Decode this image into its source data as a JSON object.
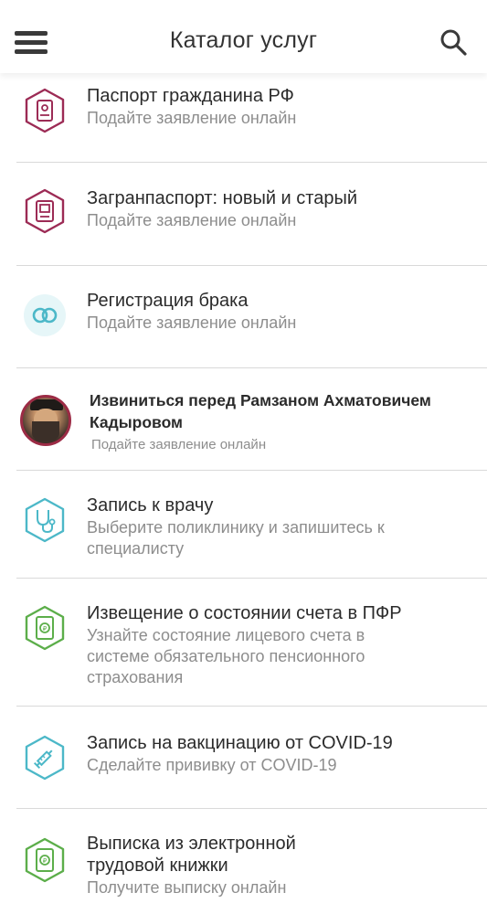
{
  "header": {
    "title": "Каталог услуг"
  },
  "items": [
    {
      "title": "Паспорт гражданина РФ",
      "subtitle": "Подайте заявление онлайн",
      "icon": "passport-icon",
      "color": "#9c2b55"
    },
    {
      "title": "Загранпаспорт: новый и старый",
      "subtitle": "Подайте заявление онлайн",
      "icon": "foreign-passport-icon",
      "color": "#9c2b55"
    },
    {
      "title": "Регистрация брака",
      "subtitle": "Подайте заявление онлайн",
      "icon": "rings-icon",
      "color": "#4cb8c8"
    },
    {
      "title_line1": "Извиниться перед Рамзаном Ахматовичем",
      "title_line2": "Кадыровом",
      "subtitle": "Подайте заявление онлайн",
      "icon": "person-photo-avatar",
      "color": "#9c2b45"
    },
    {
      "title": "Запись к врачу",
      "subtitle_line1": "Выберите поликлинику и запишитесь к",
      "subtitle_line2": "специалисту",
      "icon": "stethoscope-icon",
      "color": "#4cb8c8"
    },
    {
      "title": "Извещение о состоянии счета в ПФР",
      "subtitle_line1": "Узнайте состояние лицевого счета в",
      "subtitle_line2": "системе обязательного пенсионного",
      "subtitle_line3": "страхования",
      "icon": "pension-document-icon",
      "color": "#5cae4a"
    },
    {
      "title": "Запись на вакцинацию от COVID-19",
      "subtitle": "Сделайте прививку от COVID-19",
      "icon": "syringe-icon",
      "color": "#4cb8c8"
    },
    {
      "title_line1": "Выписка из электронной",
      "title_line2": "трудовой книжки",
      "subtitle": "Получите выписку онлайн",
      "icon": "employment-book-icon",
      "color": "#5cae4a"
    }
  ]
}
